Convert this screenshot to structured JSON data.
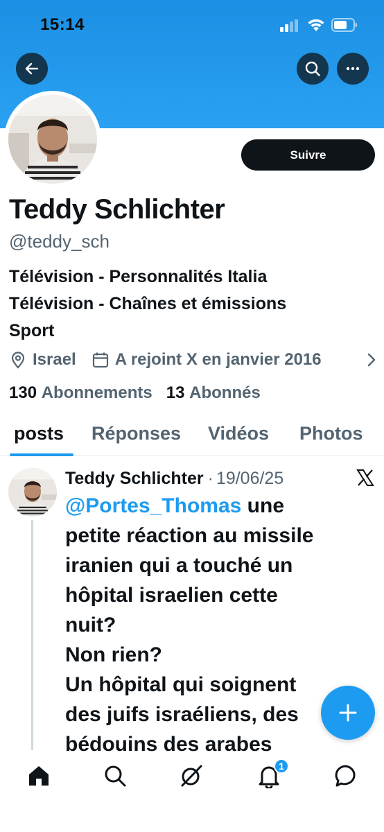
{
  "status_bar": {
    "time": "15:14"
  },
  "profile": {
    "name": "Teddy Schlichter",
    "handle": "@teddy_sch",
    "follow_label": "Suivre",
    "bio": [
      "Télévision - Personnalités Italia",
      "Télévision - Chaînes et émissions",
      "Sport"
    ],
    "location": "Israel",
    "joined": "A rejoint X en janvier 2016",
    "following_count": "130",
    "following_label": "Abonnements",
    "followers_count": "13",
    "followers_label": "Abonnés"
  },
  "tabs": [
    {
      "label": "posts",
      "active": true
    },
    {
      "label": "Réponses",
      "active": false
    },
    {
      "label": "Vidéos",
      "active": false
    },
    {
      "label": "Photos",
      "active": false
    }
  ],
  "post": {
    "author": "Teddy Schlichter",
    "separator": "·",
    "date": "19/06/25",
    "mention": "@Portes_Thomas",
    "lines": [
      " une",
      "petite réaction au missile",
      "iranien qui a touché un",
      "hôpital israelien cette",
      "nuit?",
      "Non rien?",
      "Un hôpital qui soignent",
      "des juifs israéliens, des",
      "bédouins des arabes"
    ]
  },
  "bottom_nav": {
    "items": [
      "home-icon",
      "search-icon",
      "grok-icon",
      "notifications-icon",
      "messages-icon"
    ],
    "notification_badge": "1"
  },
  "colors": {
    "banner": "#1d9bf0",
    "accent": "#1d9bf0",
    "text_primary": "#0f1419",
    "text_secondary": "#536471"
  }
}
